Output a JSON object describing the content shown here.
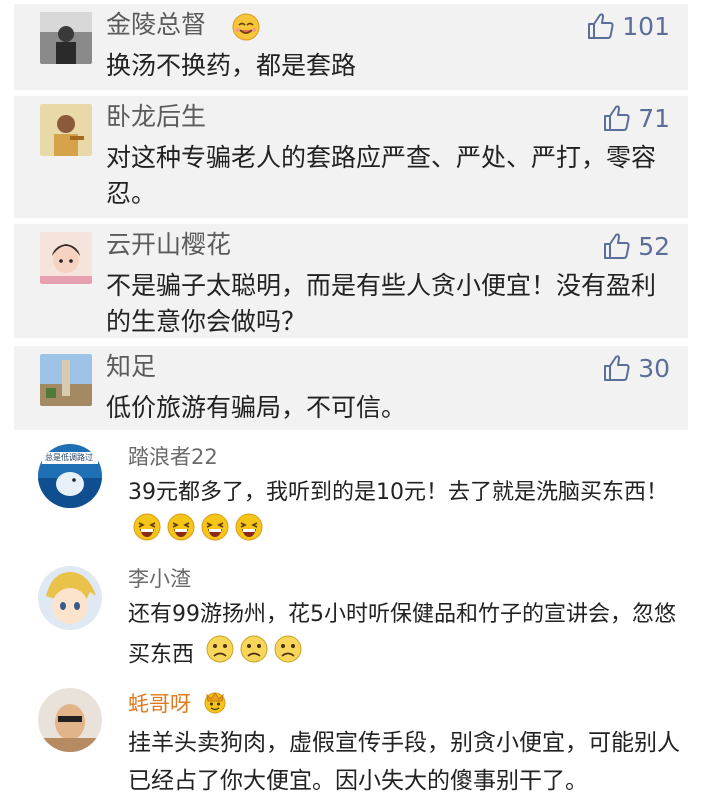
{
  "comments_top": [
    {
      "name": "金陵总督",
      "text": "换汤不换药，都是套路",
      "likes": "101",
      "avatar_icon": "person-photo-icon"
    },
    {
      "name": "卧龙后生",
      "text": "对这种专骗老人的套路应严查、严处、严打，零容忍。",
      "likes": "71",
      "avatar_icon": "person-photo-icon"
    },
    {
      "name": "云开山樱花",
      "text": "不是骗子太聪明，而是有些人贪小便宜！没有盈利的生意你会做吗？",
      "likes": "52",
      "avatar_icon": "child-photo-icon"
    },
    {
      "name": "知足",
      "text": "低价旅游有骗局，不可信。",
      "likes": "30",
      "avatar_icon": "landmark-photo-icon"
    }
  ],
  "comments_bottom": [
    {
      "name": "踏浪者22",
      "text": "39元都多了，我听到的是10元！去了就是洗脑买东西！",
      "avatar_banner": "总是低调路过"
    },
    {
      "name": "李小渣",
      "text": "还有99游扬州，花5小时听保健品和竹子的宣讲会，忽悠买东西"
    },
    {
      "name": "蚝哥呀",
      "text": "挂羊头卖狗肉，虚假宣传手段，别贪小便宜，可能别人已经占了你大便宜。因小失大的傻事别干了。",
      "name_color": "#e07a1f"
    }
  ],
  "colors": {
    "panel_bg": "#f2f2f2",
    "like_color": "#5b6e9a",
    "name_gray": "#5b5b5b",
    "emoji_yellow": "#f5c518"
  }
}
